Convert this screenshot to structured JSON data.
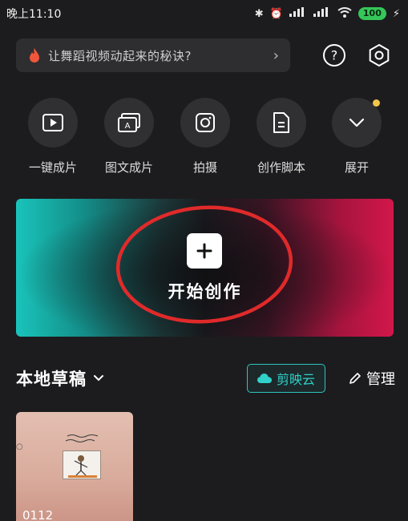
{
  "status_bar": {
    "time": "晚上11:10",
    "battery": "100",
    "signal_1": "HD",
    "signal_2": "HD"
  },
  "search": {
    "text": "让舞蹈视频动起来的秘诀?",
    "icon": "flame-icon"
  },
  "top_actions": [
    {
      "icon": "help-icon"
    },
    {
      "icon": "settings-icon"
    }
  ],
  "shortcuts": [
    {
      "label": "一键成片",
      "icon": "play-icon"
    },
    {
      "label": "图文成片",
      "icon": "text-to-video-icon"
    },
    {
      "label": "拍摄",
      "icon": "camera-icon"
    },
    {
      "label": "创作脚本",
      "icon": "script-icon"
    },
    {
      "label": "展开",
      "icon": "chevron-down-icon"
    }
  ],
  "create": {
    "label": "开始创作"
  },
  "drafts": {
    "title": "本地草稿",
    "cloud_label": "剪映云",
    "manage_label": "管理",
    "items": [
      {
        "name": "0112"
      }
    ]
  },
  "colors": {
    "accent_teal": "#2ec5bd",
    "accent_pink": "#d2174a",
    "annotation_red": "#e02a2a",
    "background": "#1c1c1e"
  }
}
